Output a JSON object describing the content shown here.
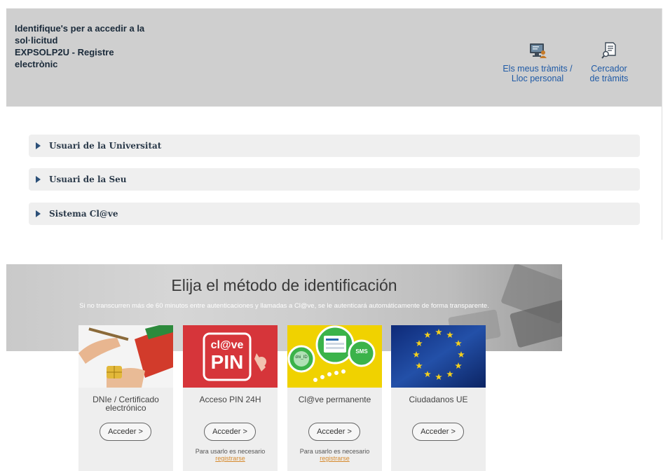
{
  "header": {
    "title_lines": [
      "Identifique's per a accedir a la",
      "sol·licitud",
      "EXPSOLP2U - Registre",
      "electrònic"
    ],
    "link_tramits": [
      "Els meus tràmits /",
      "Lloc personal"
    ],
    "link_cercador": [
      "Cercador",
      "de tràmits"
    ]
  },
  "accordion": [
    {
      "label": "Usuari de la Universitat"
    },
    {
      "label": "Usuari de la Seu"
    },
    {
      "label": "Sistema Cl@ve"
    }
  ],
  "clave": {
    "title": "Elija el método de identificación",
    "subtitle": "Si no transcurren más de 60 minutos entre autenticaciones y llamadas a Cl@ve, se le autenticará automáticamente de forma transparente.",
    "cards": [
      {
        "name_lines": [
          "DNIe / Certificado",
          "electrónico"
        ],
        "button": "Acceder  >",
        "note": "",
        "note_link": ""
      },
      {
        "name_lines": [
          "Acceso PIN 24H",
          ""
        ],
        "button": "Acceder  >",
        "note": "Para usarlo es necesario",
        "note_link": "registrarse",
        "logo_top": "cl@ve",
        "logo_bottom": "PIN"
      },
      {
        "name_lines": [
          "Cl@ve permanente",
          ""
        ],
        "button": "Acceder  >",
        "note": "Para usarlo es necesario",
        "note_link": "registrarse",
        "badge": "SMS",
        "mini_label": "dni_ID"
      },
      {
        "name_lines": [
          "Ciudadanos UE",
          ""
        ],
        "button": "Acceder  >",
        "note": "",
        "note_link": ""
      }
    ]
  },
  "colors": {
    "header_bg": "#cfcfcf",
    "link": "#1f5aa6",
    "pin_red": "#d6353a",
    "clave_yellow": "#f0d200",
    "eu_blue": "#1a3d8f",
    "register_link": "#d68a2d"
  },
  "icons": {
    "tramits": "monitor-person-icon",
    "cercador": "document-search-icon",
    "accordion": "caret-right-icon"
  }
}
